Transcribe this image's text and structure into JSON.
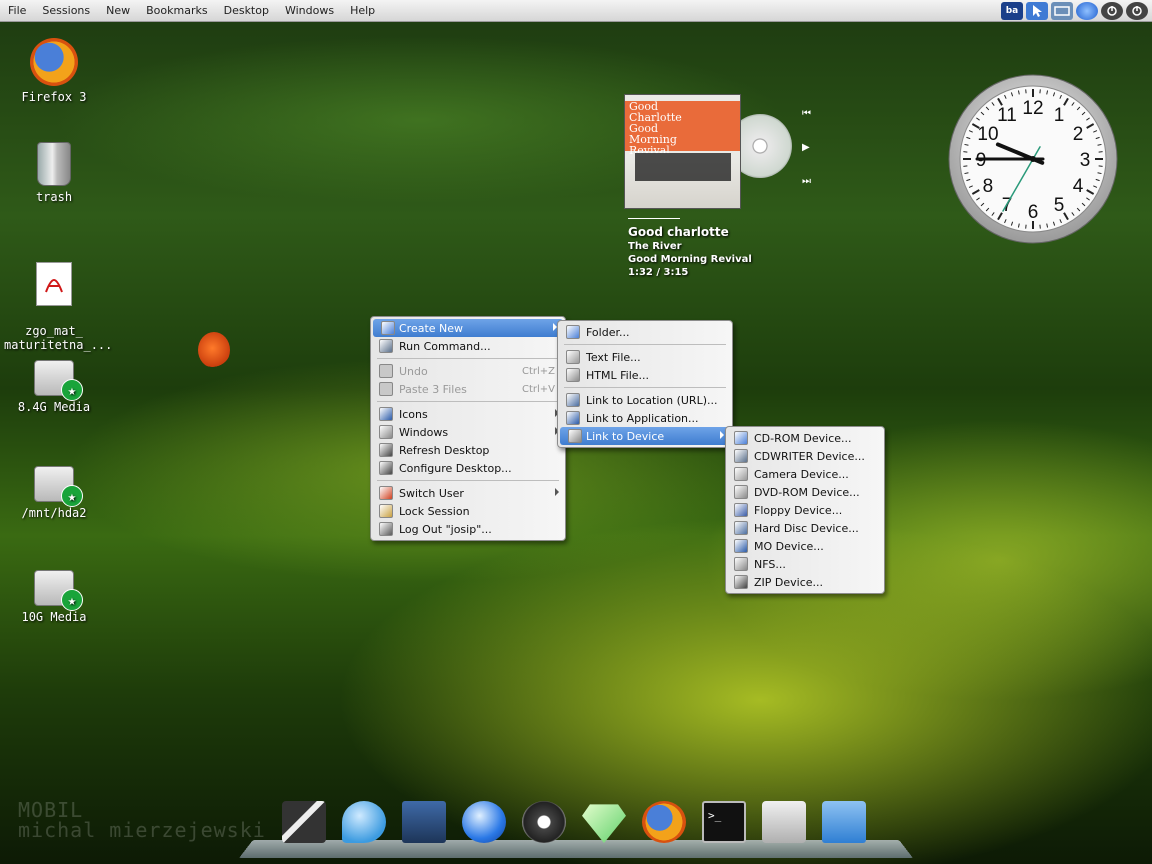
{
  "topbar": {
    "menus": [
      "File",
      "Sessions",
      "New",
      "Bookmarks",
      "Desktop",
      "Windows",
      "Help"
    ],
    "tray": [
      {
        "icon": "keyboard-layout-icon",
        "label": "ba",
        "color": "#1a3f8a"
      },
      {
        "icon": "pointer-icon",
        "color": "#3e7ad4"
      },
      {
        "icon": "network-icon",
        "color": "#6b8fb8"
      },
      {
        "icon": "pager-icon",
        "color": "#2b6fd8"
      },
      {
        "icon": "power-icon",
        "color": "#444"
      },
      {
        "icon": "logout-icon",
        "color": "#444"
      }
    ]
  },
  "desktop": {
    "icons": [
      {
        "name": "firefox-desktop-icon",
        "label": "Firefox 3"
      },
      {
        "name": "trash-desktop-icon",
        "label": "trash"
      },
      {
        "name": "pdf-desktop-icon",
        "label": "zgo_mat_\nmaturitetna_..."
      },
      {
        "name": "drive-8gb-desktop-icon",
        "label": "8.4G Media"
      },
      {
        "name": "drive-hda2-desktop-icon",
        "label": "/mnt/hda2"
      },
      {
        "name": "drive-10gb-desktop-icon",
        "label": "10G Media"
      }
    ],
    "watermark": [
      "MOBIL",
      "michal mierzejewski"
    ]
  },
  "player": {
    "cover_title": "Good Charlotte Good Morning Revival",
    "artist": "Good charlotte",
    "title": "The River",
    "album": "Good Morning Revival",
    "time": "1:32 /   3:15"
  },
  "clock": {
    "numbers": [
      "12",
      "1",
      "2",
      "3",
      "4",
      "5",
      "6",
      "7",
      "8",
      "9",
      "10",
      "11"
    ],
    "hour": 9.0,
    "minute": 45,
    "second": 25
  },
  "context_menu": {
    "items": [
      {
        "label": "Create New",
        "icon": "create-new-icon",
        "highlight": true,
        "submenu": true
      },
      {
        "label": "Run Command...",
        "icon": "run-command-icon"
      },
      {
        "sep": true
      },
      {
        "label": "Undo",
        "icon": "undo-icon",
        "shortcut": "Ctrl+Z",
        "disabled": true
      },
      {
        "label": "Paste 3 Files",
        "icon": "paste-icon",
        "shortcut": "Ctrl+V",
        "disabled": true
      },
      {
        "sep": true
      },
      {
        "label": "Icons",
        "icon": "icons-icon",
        "submenu": true
      },
      {
        "label": "Windows",
        "icon": "windows-icon",
        "submenu": true
      },
      {
        "label": "Refresh Desktop",
        "icon": "refresh-icon"
      },
      {
        "label": "Configure Desktop...",
        "icon": "configure-icon"
      },
      {
        "sep": true
      },
      {
        "label": "Switch User",
        "icon": "switch-user-icon",
        "submenu": true
      },
      {
        "label": "Lock Session",
        "icon": "lock-icon"
      },
      {
        "label": "Log Out \"josip\"...",
        "icon": "logout-icon"
      }
    ]
  },
  "create_new_menu": {
    "items": [
      {
        "label": "Folder...",
        "icon": "folder-icon"
      },
      {
        "sep": true
      },
      {
        "label": "Text File...",
        "icon": "text-file-icon"
      },
      {
        "label": "HTML File...",
        "icon": "html-file-icon"
      },
      {
        "sep": true
      },
      {
        "label": "Link to Location (URL)...",
        "icon": "link-url-icon"
      },
      {
        "label": "Link to Application...",
        "icon": "link-app-icon"
      },
      {
        "label": "Link to Device",
        "icon": "link-device-icon",
        "highlight": true,
        "submenu": true
      }
    ]
  },
  "device_menu": {
    "items": [
      {
        "label": "CD-ROM Device...",
        "icon": "cdrom-icon"
      },
      {
        "label": "CDWRITER Device...",
        "icon": "cdwriter-icon"
      },
      {
        "label": "Camera Device...",
        "icon": "camera-icon"
      },
      {
        "label": "DVD-ROM Device...",
        "icon": "dvdrom-icon"
      },
      {
        "label": "Floppy Device...",
        "icon": "floppy-icon"
      },
      {
        "label": "Hard Disc Device...",
        "icon": "hard-disc-icon"
      },
      {
        "label": "MO Device...",
        "icon": "mo-device-icon"
      },
      {
        "label": "NFS...",
        "icon": "nfs-icon"
      },
      {
        "label": "ZIP Device...",
        "icon": "zip-icon"
      }
    ]
  },
  "dock": {
    "items": [
      {
        "name": "dock-video-editor",
        "icon": "clapperboard-icon"
      },
      {
        "name": "dock-chat",
        "icon": "chat-bubble-icon"
      },
      {
        "name": "dock-system-settings",
        "icon": "settings-tools-icon"
      },
      {
        "name": "dock-network-browser",
        "icon": "blue-orb-icon"
      },
      {
        "name": "dock-amarok",
        "icon": "wolf-icon"
      },
      {
        "name": "dock-gem",
        "icon": "gem-icon"
      },
      {
        "name": "dock-firefox",
        "icon": "firefox-icon"
      },
      {
        "name": "dock-terminal",
        "icon": "terminal-icon"
      },
      {
        "name": "dock-package-manager",
        "icon": "package-icon"
      },
      {
        "name": "dock-file-manager",
        "icon": "folder-icon"
      }
    ]
  }
}
